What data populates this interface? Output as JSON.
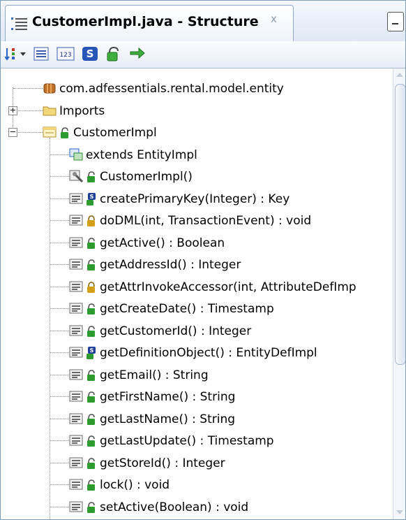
{
  "panel": {
    "title": "CustomerImpl.java - Structure",
    "close_label": "x"
  },
  "toolbar": {
    "icons": [
      "sort-icon",
      "list-view-icon",
      "numbered-view-icon",
      "static-members-icon",
      "inherited-members-icon",
      "sync-icon"
    ]
  },
  "tree": {
    "nodes": [
      {
        "label": "com.adfessentials.rental.model.entity",
        "icon": "package-icon",
        "level": 0,
        "expander": "none",
        "access": "none"
      },
      {
        "label": "Imports",
        "icon": "folder-icon",
        "level": 0,
        "expander": "plus",
        "access": "none"
      },
      {
        "label": "CustomerImpl",
        "icon": "class-icon",
        "level": 0,
        "expander": "minus",
        "access": "public"
      },
      {
        "label": "extends EntityImpl",
        "icon": "extends-icon",
        "level": 1,
        "expander": "none",
        "access": "none"
      },
      {
        "label": "CustomerImpl()",
        "icon": "constructor-icon",
        "level": 1,
        "expander": "none",
        "access": "public"
      },
      {
        "label": "createPrimaryKey(Integer) : Key",
        "icon": "method-icon",
        "level": 1,
        "expander": "none",
        "access": "public-static"
      },
      {
        "label": "doDML(int, TransactionEvent) : void",
        "icon": "method-icon",
        "level": 1,
        "expander": "none",
        "access": "protected"
      },
      {
        "label": "getActive() : Boolean",
        "icon": "method-icon",
        "level": 1,
        "expander": "none",
        "access": "public"
      },
      {
        "label": "getAddressId() : Integer",
        "icon": "method-icon",
        "level": 1,
        "expander": "none",
        "access": "public"
      },
      {
        "label": "getAttrInvokeAccessor(int, AttributeDefImp",
        "icon": "method-icon",
        "level": 1,
        "expander": "none",
        "access": "protected"
      },
      {
        "label": "getCreateDate() : Timestamp",
        "icon": "method-icon",
        "level": 1,
        "expander": "none",
        "access": "public"
      },
      {
        "label": "getCustomerId() : Integer",
        "icon": "method-icon",
        "level": 1,
        "expander": "none",
        "access": "public"
      },
      {
        "label": "getDefinitionObject() : EntityDefImpl",
        "icon": "method-icon",
        "level": 1,
        "expander": "none",
        "access": "public-static"
      },
      {
        "label": "getEmail() : String",
        "icon": "method-icon",
        "level": 1,
        "expander": "none",
        "access": "public"
      },
      {
        "label": "getFirstName() : String",
        "icon": "method-icon",
        "level": 1,
        "expander": "none",
        "access": "public"
      },
      {
        "label": "getLastName() : String",
        "icon": "method-icon",
        "level": 1,
        "expander": "none",
        "access": "public"
      },
      {
        "label": "getLastUpdate() : Timestamp",
        "icon": "method-icon",
        "level": 1,
        "expander": "none",
        "access": "public"
      },
      {
        "label": "getStoreId() : Integer",
        "icon": "method-icon",
        "level": 1,
        "expander": "none",
        "access": "public"
      },
      {
        "label": "lock() : void",
        "icon": "method-icon",
        "level": 1,
        "expander": "none",
        "access": "public"
      },
      {
        "label": "setActive(Boolean) : void",
        "icon": "method-icon",
        "level": 1,
        "expander": "none",
        "access": "public"
      }
    ]
  },
  "colors": {
    "tab_border": "#8fa6c6",
    "access_public": "#2e9b2e",
    "access_protected": "#d4a017",
    "static_badge": "#1f3f9a",
    "folder": "#f2d77a"
  }
}
